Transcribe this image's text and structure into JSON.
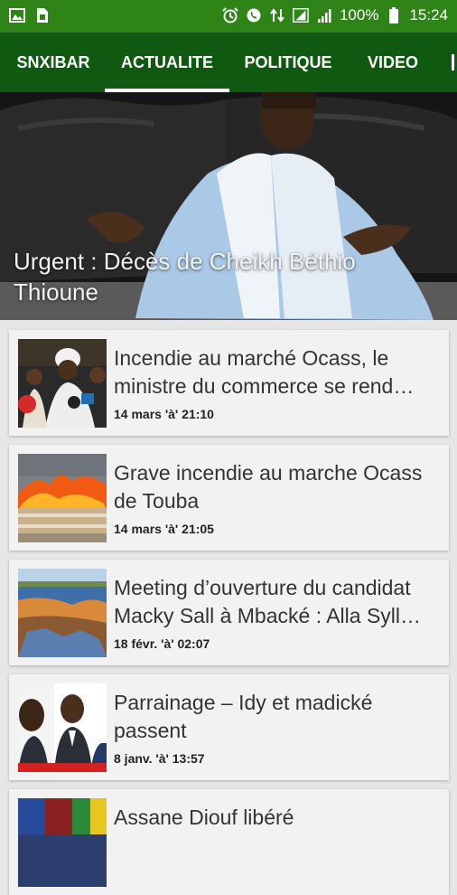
{
  "status": {
    "battery": "100%",
    "time": "15:24",
    "icons": [
      "gallery-icon",
      "sim-card-icon",
      "alarm-icon",
      "whatsapp-icon",
      "data-arrows-icon",
      "signal-icon",
      "battery-icon"
    ]
  },
  "tabs": [
    "SNXIBAR",
    "ACTUALITE",
    "POLITIQUE",
    "VIDEO"
  ],
  "active_tab": "ACTUALITE",
  "hero": {
    "title": "Urgent : Décès de Cheikh Béthio Thioune"
  },
  "articles": [
    {
      "title": "Incendie au marché Ocass, le ministre du commerce se rend…",
      "date": "14 mars 'à' 21:10"
    },
    {
      "title": "Grave incendie au marche Ocass de Touba",
      "date": "14 mars 'à' 21:05"
    },
    {
      "title": "Meeting d’ouverture du candidat Macky Sall à Mbacké : Alla Syll…",
      "date": "18 févr. 'à' 02:07"
    },
    {
      "title": "Parrainage – Idy et madické passent",
      "date": "8 janv. 'à' 13:57"
    },
    {
      "title": "Assane Diouf libéré",
      "date": ""
    }
  ],
  "colors": {
    "status_bar": "#2f8417",
    "tab_bar": "#0f5a10",
    "indicator": "#ffffff"
  }
}
